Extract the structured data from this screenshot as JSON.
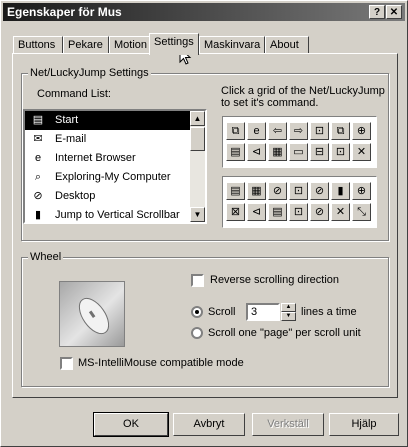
{
  "window": {
    "title": "Egenskaper för Mus",
    "help_label": "?",
    "close_label": "✕"
  },
  "tabs": [
    {
      "label": "Buttons"
    },
    {
      "label": "Pekare"
    },
    {
      "label": "Motion"
    },
    {
      "label": "Settings"
    },
    {
      "label": "Maskinvara"
    },
    {
      "label": "About"
    }
  ],
  "active_tab": "Settings",
  "netlucky": {
    "group_label": "Net/LuckyJump Settings",
    "command_list_label": "Command List:",
    "grid_hint": "Click a grid of the Net/LuckyJump to set it's command.",
    "commands": [
      {
        "label": "Start",
        "icon": "start-icon",
        "glyph": "▤"
      },
      {
        "label": "E-mail",
        "icon": "email-icon",
        "glyph": "✉"
      },
      {
        "label": "Internet Browser",
        "icon": "browser-icon",
        "glyph": "e"
      },
      {
        "label": "Exploring-My Computer",
        "icon": "explore-icon",
        "glyph": "⌕"
      },
      {
        "label": "Desktop",
        "icon": "desktop-icon",
        "glyph": "⊘"
      },
      {
        "label": "Jump to Vertical Scrollbar",
        "icon": "scrollbar-icon",
        "glyph": "▮"
      }
    ],
    "selected_command": "Start",
    "grid1": [
      "⧉",
      "e",
      "⇦",
      "⇨",
      "⊡",
      "⧉",
      "⊕",
      "▤",
      "⊲",
      "▦",
      "▭",
      "⊟",
      "⊡",
      "✕"
    ],
    "grid2": [
      "▤",
      "▦",
      "⊘",
      "⊡",
      "⊘",
      "▮",
      "⊕",
      "⊠",
      "⊲",
      "▤",
      "⊡",
      "⊘",
      "✕",
      "⤡"
    ]
  },
  "wheel": {
    "group_label": "Wheel",
    "reverse_label": "Reverse scrolling direction",
    "scroll_label": "Scroll",
    "scroll_value": "3",
    "lines_label": "lines a time",
    "page_label": "Scroll one \"page\" per scroll unit",
    "intellimouse_label": "MS-IntelliMouse compatible mode"
  },
  "buttons": {
    "ok": "OK",
    "cancel": "Avbryt",
    "apply": "Verkställ",
    "help": "Hjälp"
  }
}
